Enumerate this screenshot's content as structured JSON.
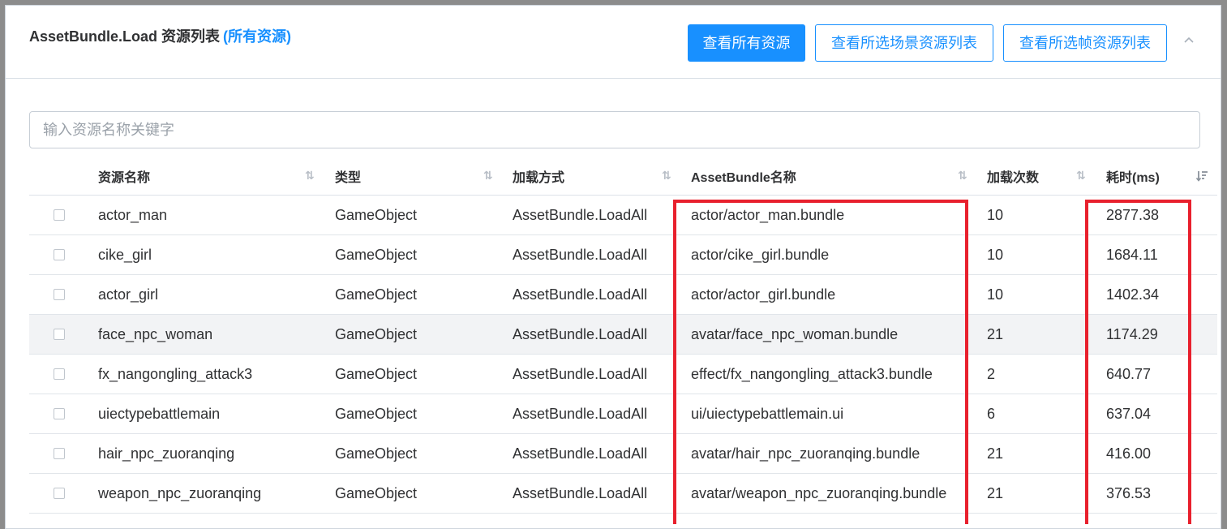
{
  "header": {
    "title": "AssetBundle.Load 资源列表",
    "title_tag": "(所有资源)",
    "buttons": {
      "all": "查看所有资源",
      "scene": "查看所选场景资源列表",
      "frame": "查看所选帧资源列表"
    },
    "collapse_icon": "chevron-up-icon"
  },
  "search": {
    "placeholder": "输入资源名称关键字",
    "value": ""
  },
  "table": {
    "columns": {
      "name": "资源名称",
      "type": "类型",
      "mode": "加载方式",
      "bundle": "AssetBundle名称",
      "count": "加载次数",
      "time": "耗时(ms)"
    },
    "sort_glyph": "⇅",
    "sort_active_glyph": "⇃",
    "rows": [
      {
        "name": "actor_man",
        "type": "GameObject",
        "mode": "AssetBundle.LoadAll",
        "bundle": "actor/actor_man.bundle",
        "count": "10",
        "time": "2877.38"
      },
      {
        "name": "cike_girl",
        "type": "GameObject",
        "mode": "AssetBundle.LoadAll",
        "bundle": "actor/cike_girl.bundle",
        "count": "10",
        "time": "1684.11"
      },
      {
        "name": "actor_girl",
        "type": "GameObject",
        "mode": "AssetBundle.LoadAll",
        "bundle": "actor/actor_girl.bundle",
        "count": "10",
        "time": "1402.34"
      },
      {
        "name": "face_npc_woman",
        "type": "GameObject",
        "mode": "AssetBundle.LoadAll",
        "bundle": "avatar/face_npc_woman.bundle",
        "count": "21",
        "time": "1174.29"
      },
      {
        "name": "fx_nangongling_attack3",
        "type": "GameObject",
        "mode": "AssetBundle.LoadAll",
        "bundle": "effect/fx_nangongling_attack3.bundle",
        "count": "2",
        "time": "640.77"
      },
      {
        "name": "uiectypebattlemain",
        "type": "GameObject",
        "mode": "AssetBundle.LoadAll",
        "bundle": "ui/uiectypebattlemain.ui",
        "count": "6",
        "time": "637.04"
      },
      {
        "name": "hair_npc_zuoranqing",
        "type": "GameObject",
        "mode": "AssetBundle.LoadAll",
        "bundle": "avatar/hair_npc_zuoranqing.bundle",
        "count": "21",
        "time": "416.00"
      },
      {
        "name": "weapon_npc_zuoranqing",
        "type": "GameObject",
        "mode": "AssetBundle.LoadAll",
        "bundle": "avatar/weapon_npc_zuoranqing.bundle",
        "count": "21",
        "time": "376.53"
      }
    ]
  },
  "colors": {
    "accent": "#1890ff",
    "highlight": "#e8202d",
    "hover_row": "#f2f3f5"
  }
}
